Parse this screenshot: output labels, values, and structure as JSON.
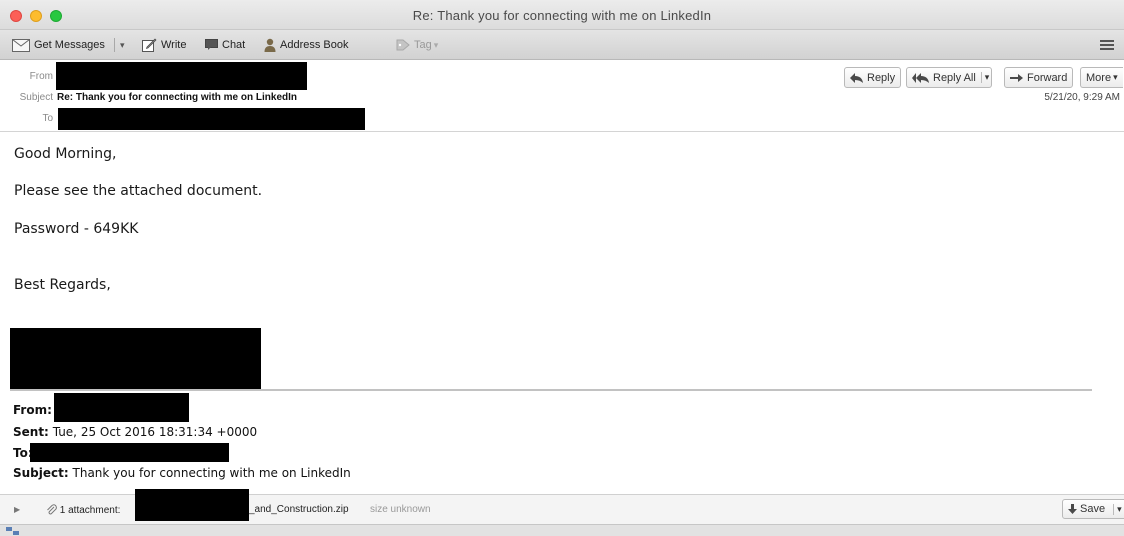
{
  "window": {
    "title": "Re: Thank you for connecting with me on LinkedIn"
  },
  "toolbar": {
    "get_messages": "Get Messages",
    "write": "Write",
    "chat": "Chat",
    "address_book": "Address Book",
    "tag": "Tag"
  },
  "header": {
    "from_label": "From",
    "subject_label": "Subject",
    "subject": "Re: Thank you for connecting with me on LinkedIn",
    "to_label": "To",
    "reply": "Reply",
    "reply_all": "Reply All",
    "forward": "Forward",
    "more": "More",
    "date": "5/21/20, 9:29 AM"
  },
  "body": {
    "greeting": "Good Morning,",
    "line1": "Please see the attached document.",
    "password": "Password - 649KK",
    "signoff": "Best Regards,"
  },
  "quoted": {
    "from_label": "From:",
    "sent_label": "Sent:",
    "sent_value": "Tue, 25 Oct 2016 18:31:34 +0000",
    "to_label": "To:",
    "subject_label": "Subject:",
    "subject_value": "Thank you for connecting with me on LinkedIn"
  },
  "attachments": {
    "count_label": "1 attachment:",
    "filename_suffix": "_and_Construction.zip",
    "size": "size unknown",
    "save": "Save"
  },
  "colors": {
    "redaction": "#000000",
    "traffic_red": "#fc5f57",
    "traffic_yellow": "#fdbc2e",
    "traffic_green": "#28c840"
  }
}
